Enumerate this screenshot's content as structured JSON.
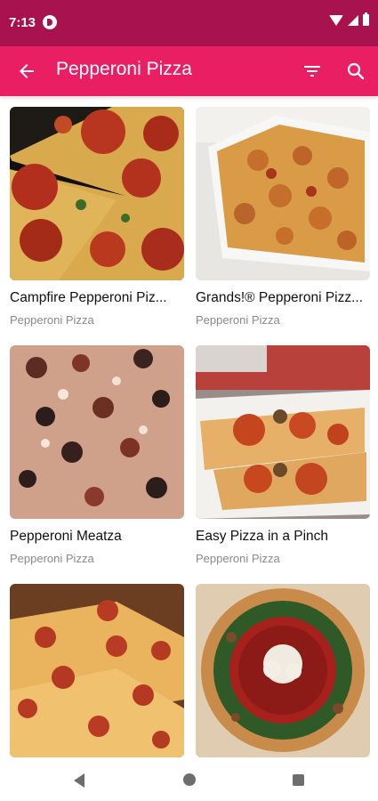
{
  "status": {
    "time": "7:13"
  },
  "app_bar": {
    "title": "Pepperoni Pizza"
  },
  "recipes": [
    {
      "title": "Campfire Pepperoni Piz...",
      "category": "Pepperoni Pizza"
    },
    {
      "title": "Grands!® Pepperoni Pizz...",
      "category": "Pepperoni Pizza"
    },
    {
      "title": "Pepperoni Meatza",
      "category": "Pepperoni Pizza"
    },
    {
      "title": "Easy Pizza in a Pinch",
      "category": "Pepperoni Pizza"
    },
    {
      "title": "",
      "category": ""
    },
    {
      "title": "",
      "category": ""
    }
  ],
  "colors": {
    "status_bar": "#a8134f",
    "app_bar": "#e91e63"
  }
}
